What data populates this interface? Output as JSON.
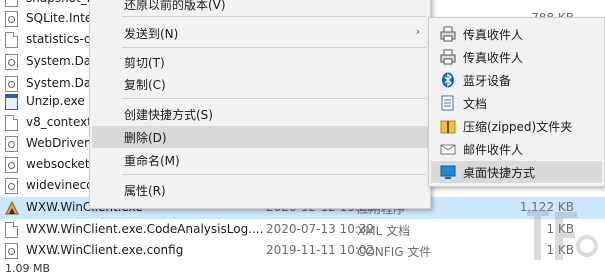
{
  "files": [
    {
      "name": "snapshot_b",
      "icon": "file-icon",
      "date": "",
      "type": "",
      "size": ""
    },
    {
      "name": "SQLite.Inte",
      "icon": "config-file-icon",
      "date": "",
      "type": "",
      "size": "788 KB"
    },
    {
      "name": "statistics-co",
      "icon": "file-icon",
      "date": "",
      "type": "",
      "size": ""
    },
    {
      "name": "System.Dat",
      "icon": "config-file-icon",
      "date": "",
      "type": "",
      "size": ""
    },
    {
      "name": "System.Dat",
      "icon": "config-file-icon",
      "date": "",
      "type": "",
      "size": ""
    },
    {
      "name": "Unzip.exe",
      "icon": "exe-icon",
      "date": "",
      "type": "",
      "size": ""
    },
    {
      "name": "v8_context_",
      "icon": "file-icon",
      "date": "",
      "type": "",
      "size": ""
    },
    {
      "name": "WebDriver",
      "icon": "config-file-icon",
      "date": "",
      "type": "",
      "size": ""
    },
    {
      "name": "websocket",
      "icon": "config-file-icon",
      "date": "",
      "type": "",
      "size": ""
    },
    {
      "name": "widevinecd",
      "icon": "config-file-icon",
      "date": "",
      "type": "",
      "size": ""
    },
    {
      "name": "WXW.WinClient.exe",
      "icon": "wxw-app-icon",
      "date": "2020-12-12 15:22",
      "type": "应用程序",
      "size": "1,122 KB",
      "selected": true
    },
    {
      "name": "WXW.WinClient.exe.CodeAnalysisLog....",
      "icon": "file-icon",
      "date": "2020-07-13 10:32",
      "type": "XML 文档",
      "size": "1 KB"
    },
    {
      "name": "WXW.WinClient.exe.config",
      "icon": "config-file-icon",
      "date": "2019-11-11 10:02",
      "type": "CONFIG 文件",
      "size": "1 KB"
    }
  ],
  "status_bar": {
    "size_text": "1.09 MB"
  },
  "context_menu": {
    "items": [
      {
        "label": "还原以前的版本(V)"
      },
      {
        "label": "发送到(N)",
        "submenu_arrow": "›"
      },
      {
        "label": "剪切(T)"
      },
      {
        "label": "复制(C)"
      },
      {
        "label": "创建快捷方式(S)"
      },
      {
        "label": "删除(D)",
        "highlighted": true
      },
      {
        "label": "重命名(M)"
      },
      {
        "label": "属性(R)"
      }
    ]
  },
  "submenu": {
    "items": [
      {
        "label": "传真收件人",
        "icon": "fax-printer-icon"
      },
      {
        "label": "传真收件人",
        "icon": "fax-printer-icon"
      },
      {
        "label": "蓝牙设备",
        "icon": "bluetooth-icon"
      },
      {
        "label": "文档",
        "icon": "document-icon"
      },
      {
        "label": "压缩(zipped)文件夹",
        "icon": "zip-folder-icon"
      },
      {
        "label": "邮件收件人",
        "icon": "mail-icon"
      },
      {
        "label": "桌面快捷方式",
        "icon": "desktop-icon",
        "highlighted": true
      }
    ]
  },
  "colors": {
    "selection_row": "#cce8ff",
    "menu_bg": "#f2f2f2",
    "menu_highlight": "#dadada",
    "bluetooth": "#0a63c9",
    "desktop": "#1a8ad6"
  }
}
